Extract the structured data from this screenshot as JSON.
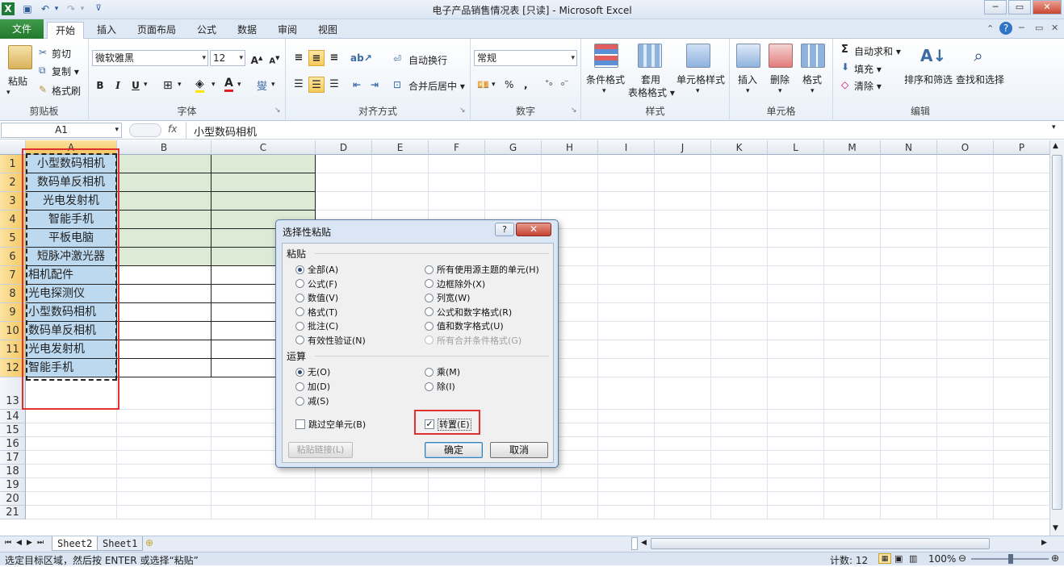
{
  "window": {
    "title": "电子产品销售情况表 [只读] - Microsoft Excel",
    "min": "─",
    "max": "▭",
    "close": "✕"
  },
  "ribbon_tabs": [
    "文件",
    "开始",
    "插入",
    "页面布局",
    "公式",
    "数据",
    "审阅",
    "视图"
  ],
  "clipboard": {
    "paste": "粘贴",
    "cut": "剪切",
    "copy": "复制 ▾",
    "format_painter": "格式刷",
    "label": "剪贴板"
  },
  "font": {
    "name": "微软雅黑",
    "size": "12",
    "label": "字体",
    "bold": "B",
    "italic": "I",
    "underline": "U"
  },
  "alignment": {
    "wrap": "自动换行",
    "merge": "合并后居中 ▾",
    "label": "对齐方式"
  },
  "number": {
    "format": "常规",
    "percent": "%",
    "comma": ",",
    "label": "数字"
  },
  "styles": {
    "conditional": "条件格式",
    "table1": "套用",
    "table2": "表格格式 ▾",
    "cell": "单元格样式",
    "label": "样式"
  },
  "cells": {
    "insert": "插入",
    "delete": "删除",
    "format": "格式",
    "label": "单元格"
  },
  "editing": {
    "autosum": "自动求和 ▾",
    "fill": "填充 ▾",
    "clear": "清除 ▾",
    "sort": "排序和筛选",
    "find": "查找和选择",
    "label": "编辑"
  },
  "formula_bar": {
    "name_box": "A1",
    "fx": "fx",
    "value": "小型数码相机"
  },
  "columns": [
    "A",
    "B",
    "C",
    "D",
    "E",
    "F",
    "G",
    "H",
    "I",
    "J",
    "K",
    "L",
    "M",
    "N",
    "O",
    "P"
  ],
  "rows": [
    "1",
    "2",
    "3",
    "4",
    "5",
    "6",
    "7",
    "8",
    "9",
    "10",
    "11",
    "12",
    "13",
    "14",
    "15",
    "16",
    "17",
    "18",
    "19",
    "20",
    "21"
  ],
  "colA": [
    "小型数码相机",
    "数码单反相机",
    "光电发射机",
    "智能手机",
    "平板电脑",
    "短脉冲激光器",
    "相机配件",
    "光电探测仪",
    "小型数码相机",
    "数码单反相机",
    "光电发射机",
    "智能手机"
  ],
  "sheet_tabs": [
    "Sheet2",
    "Sheet1"
  ],
  "status": {
    "message": "选定目标区域，然后按 ENTER 或选择“粘贴”",
    "count": "计数: 12",
    "zoom": "100%"
  },
  "dialog": {
    "title": "选择性粘贴",
    "help": "?",
    "close": "✕",
    "paste_section": "粘贴",
    "paste_left": [
      "全部(A)",
      "公式(F)",
      "数值(V)",
      "格式(T)",
      "批注(C)",
      "有效性验证(N)"
    ],
    "paste_right": [
      "所有使用源主题的单元(H)",
      "边框除外(X)",
      "列宽(W)",
      "公式和数字格式(R)",
      "值和数字格式(U)",
      "所有合并条件格式(G)"
    ],
    "op_section": "运算",
    "op_left": [
      "无(O)",
      "加(D)",
      "减(S)"
    ],
    "op_right": [
      "乘(M)",
      "除(I)"
    ],
    "skip_blanks": "跳过空单元(B)",
    "transpose": "转置(E)",
    "transpose_checked": true,
    "paste_link": "粘贴链接(L)",
    "ok": "确定",
    "cancel": "取消"
  }
}
